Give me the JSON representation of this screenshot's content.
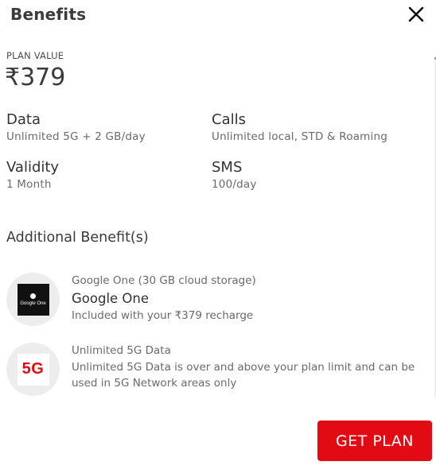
{
  "header": {
    "title": "Benefits",
    "close_icon": "close-icon"
  },
  "plan": {
    "label": "PLAN VALUE",
    "value": "₹379"
  },
  "details": {
    "data": {
      "title": "Data",
      "value": "Unlimited 5G + 2 GB/day"
    },
    "calls": {
      "title": "Calls",
      "value": "Unlimited local, STD & Roaming"
    },
    "validity": {
      "title": "Validity",
      "value": "1 Month"
    },
    "sms": {
      "title": "SMS",
      "value": "100/day"
    }
  },
  "additional": {
    "heading": "Additional Benefit(s)",
    "items": [
      {
        "icon": "google-one-icon",
        "icon_text": "Google One",
        "subtitle": "Google One (30 GB cloud storage)",
        "name": "Google One",
        "description": "Included with your ₹379 recharge"
      },
      {
        "icon": "5g-icon",
        "icon_text": "5G",
        "subtitle": "Unlimited 5G Data",
        "description": "Unlimited 5G Data is over and above your plan limit and can be used in 5G Network areas only"
      }
    ]
  },
  "cta": {
    "label": "GET PLAN"
  },
  "colors": {
    "accent": "#e30b13",
    "text": "#3a3a3a",
    "muted": "#6a6a6a",
    "icon_bg": "#ededed"
  }
}
